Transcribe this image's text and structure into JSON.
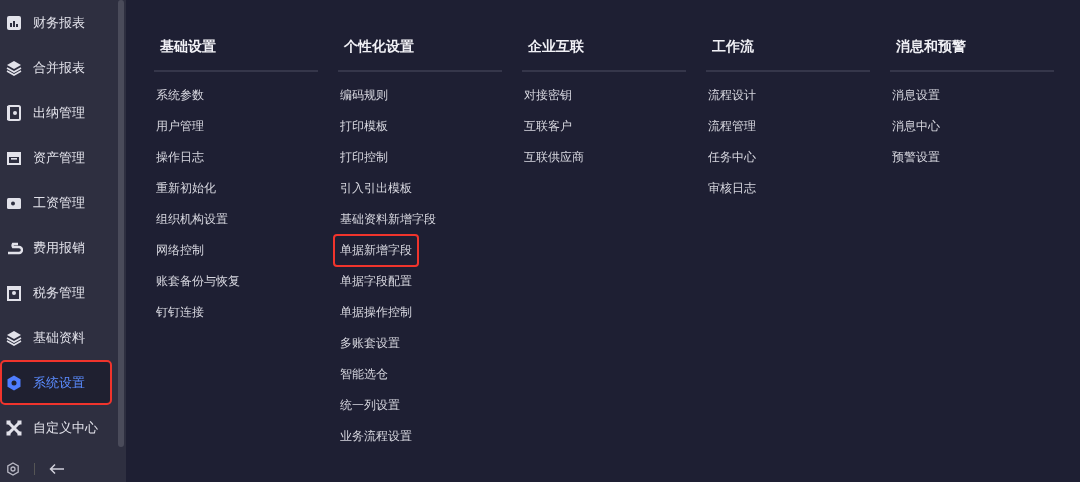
{
  "sidebar": {
    "items": [
      {
        "label": "财务报表",
        "selected": false,
        "highlighted": false
      },
      {
        "label": "合并报表",
        "selected": false,
        "highlighted": false
      },
      {
        "label": "出纳管理",
        "selected": false,
        "highlighted": false
      },
      {
        "label": "资产管理",
        "selected": false,
        "highlighted": false
      },
      {
        "label": "工资管理",
        "selected": false,
        "highlighted": false
      },
      {
        "label": "费用报销",
        "selected": false,
        "highlighted": false
      },
      {
        "label": "税务管理",
        "selected": false,
        "highlighted": false
      },
      {
        "label": "基础资料",
        "selected": false,
        "highlighted": false
      },
      {
        "label": "系统设置",
        "selected": true,
        "highlighted": true
      },
      {
        "label": "自定义中心",
        "selected": false,
        "highlighted": false
      }
    ]
  },
  "menu": {
    "columns": [
      {
        "title": "基础设置",
        "items": [
          {
            "label": "系统参数",
            "highlighted": false
          },
          {
            "label": "用户管理",
            "highlighted": false
          },
          {
            "label": "操作日志",
            "highlighted": false
          },
          {
            "label": "重新初始化",
            "highlighted": false
          },
          {
            "label": "组织机构设置",
            "highlighted": false
          },
          {
            "label": "网络控制",
            "highlighted": false
          },
          {
            "label": "账套备份与恢复",
            "highlighted": false
          },
          {
            "label": "钉钉连接",
            "highlighted": false
          }
        ]
      },
      {
        "title": "个性化设置",
        "items": [
          {
            "label": "编码规则",
            "highlighted": false
          },
          {
            "label": "打印模板",
            "highlighted": false
          },
          {
            "label": "打印控制",
            "highlighted": false
          },
          {
            "label": "引入引出模板",
            "highlighted": false
          },
          {
            "label": "基础资料新增字段",
            "highlighted": false
          },
          {
            "label": "单据新增字段",
            "highlighted": true
          },
          {
            "label": "单据字段配置",
            "highlighted": false
          },
          {
            "label": "单据操作控制",
            "highlighted": false
          },
          {
            "label": "多账套设置",
            "highlighted": false
          },
          {
            "label": "智能选仓",
            "highlighted": false
          },
          {
            "label": "统一列设置",
            "highlighted": false
          },
          {
            "label": "业务流程设置",
            "highlighted": false
          }
        ]
      },
      {
        "title": "企业互联",
        "items": [
          {
            "label": "对接密钥",
            "highlighted": false
          },
          {
            "label": "互联客户",
            "highlighted": false
          },
          {
            "label": "互联供应商",
            "highlighted": false
          }
        ]
      },
      {
        "title": "工作流",
        "items": [
          {
            "label": "流程设计",
            "highlighted": false
          },
          {
            "label": "流程管理",
            "highlighted": false
          },
          {
            "label": "任务中心",
            "highlighted": false
          },
          {
            "label": "审核日志",
            "highlighted": false
          }
        ]
      },
      {
        "title": "消息和预警",
        "items": [
          {
            "label": "消息设置",
            "highlighted": false
          },
          {
            "label": "消息中心",
            "highlighted": false
          },
          {
            "label": "预警设置",
            "highlighted": false
          }
        ]
      }
    ]
  }
}
